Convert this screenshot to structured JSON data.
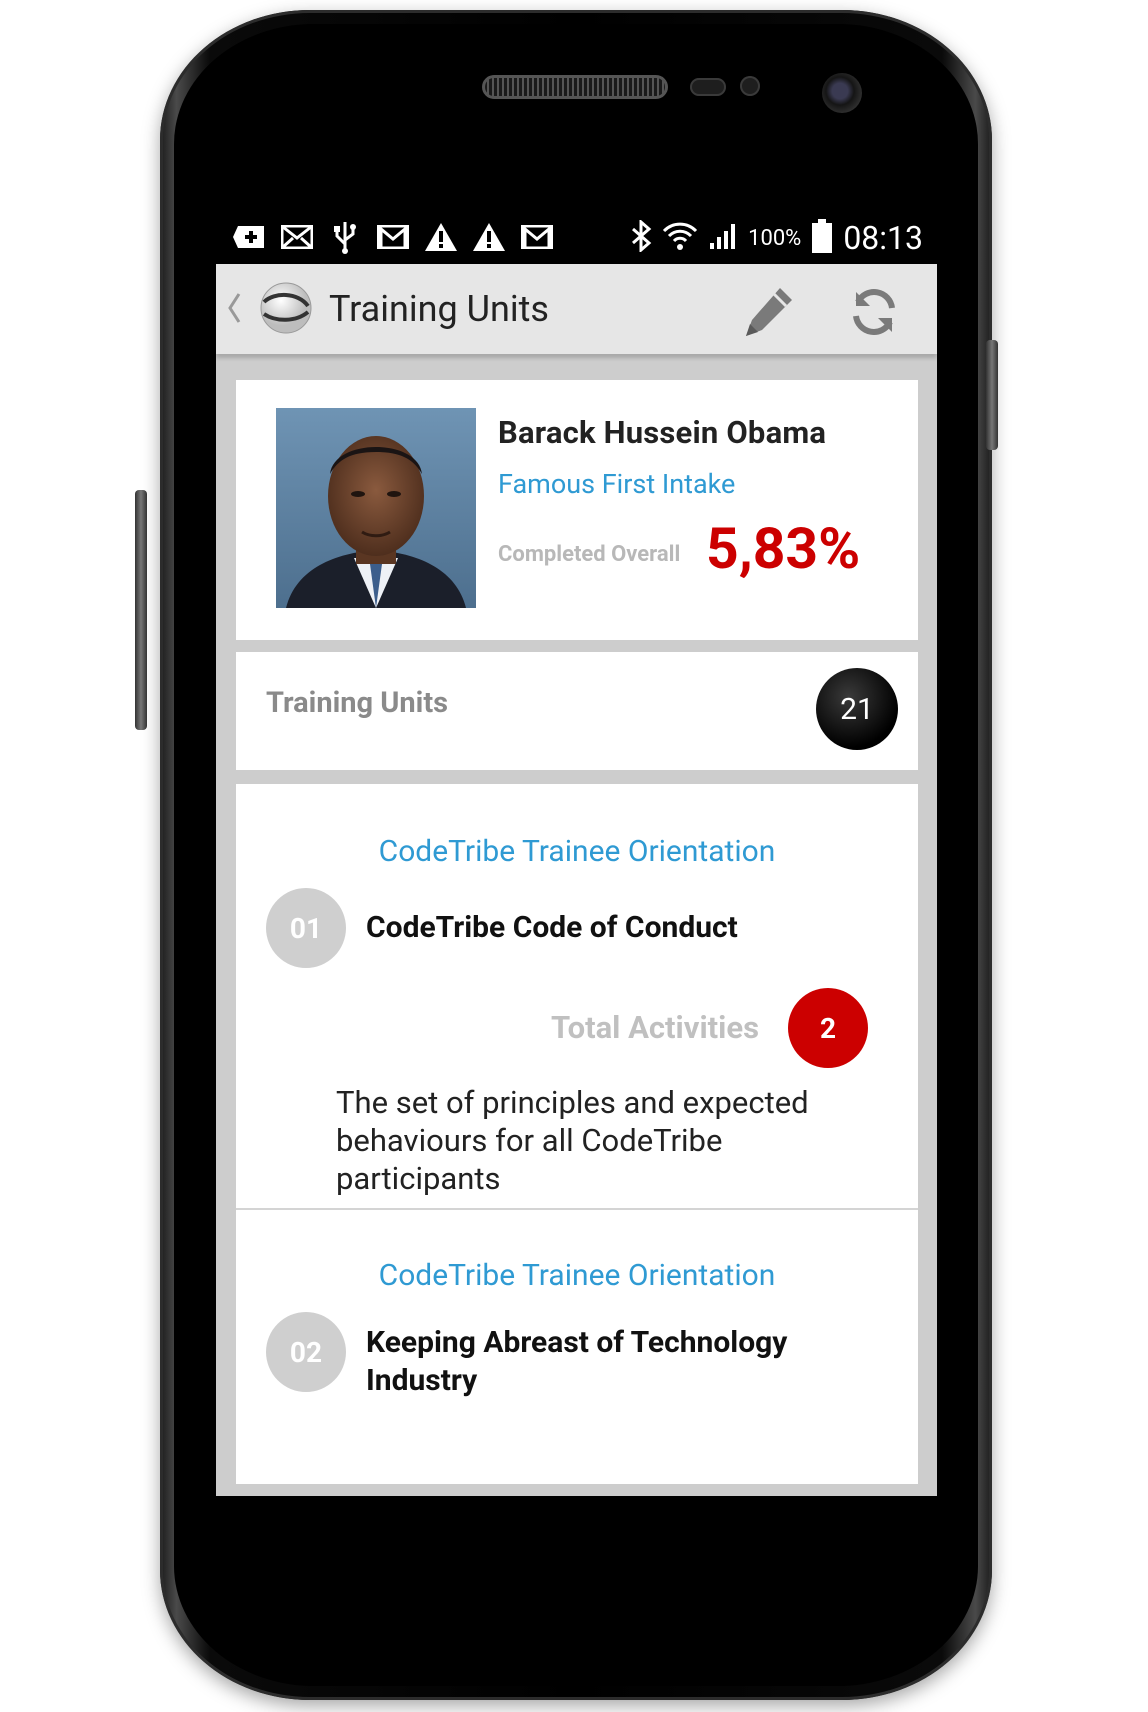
{
  "statusbar": {
    "notification_icons": [
      "plus-box-icon",
      "mail-icon",
      "usb-icon",
      "gmail-icon",
      "warning-icon",
      "warning-icon",
      "gmail-icon"
    ],
    "battery_text": "100%",
    "time": "08:13"
  },
  "actionbar": {
    "title": "Training Units"
  },
  "profile": {
    "name": "Barack Hussein Obama",
    "intake": "Famous First Intake",
    "completed_label": "Completed Overall",
    "completed_value": "5,83%"
  },
  "units_header": {
    "label": "Training Units",
    "count": "21"
  },
  "units": [
    {
      "course": "CodeTribe Trainee Orientation",
      "number": "01",
      "title": "CodeTribe Code of Conduct",
      "activities_label": "Total Activities",
      "activities_count": "2",
      "description": "The set of principles and expected behaviours for all CodeTribe participants"
    },
    {
      "course": "CodeTribe Trainee Orientation",
      "number": "02",
      "title": "Keeping Abreast of Technology Industry"
    }
  ],
  "colors": {
    "accent_blue": "#2f9ad3",
    "alert_red": "#cc0000",
    "badge_black": "#000000",
    "screen_bg": "#cdcdcd"
  }
}
